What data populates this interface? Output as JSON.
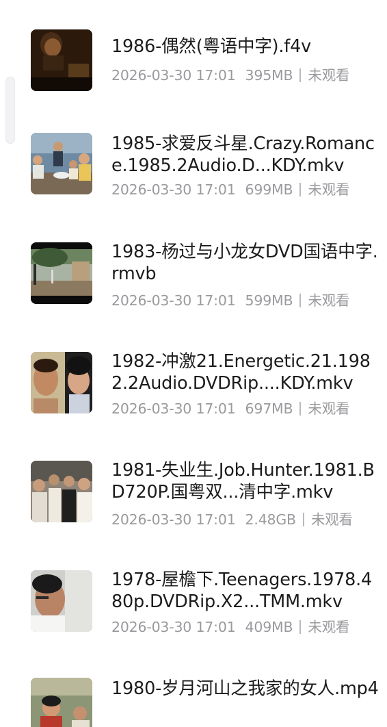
{
  "videos": [
    {
      "title": "1986-偶然(粤语中字).f4v",
      "date": "2026-03-30 17:01",
      "size": "395MB",
      "status": "未观看",
      "thumbnail": "dark-portrait-thumbnail"
    },
    {
      "title": "1985-求爱反斗星.Crazy.Romance.1985.2Audio.D...KDY.mkv",
      "date": "2026-03-30 17:01",
      "size": "699MB",
      "status": "未观看",
      "thumbnail": "classroom-group-thumbnail"
    },
    {
      "title": "1983-杨过与小龙女DVD国语中字.rmvb",
      "date": "2026-03-30 17:01",
      "size": "599MB",
      "status": "未观看",
      "thumbnail": "outdoor-tree-scene-thumbnail"
    },
    {
      "title": "1982-冲激21.Energetic.21.1982.2Audio.DVDRip....KDY.mkv",
      "date": "2026-03-30 17:01",
      "size": "697MB",
      "status": "未观看",
      "thumbnail": "two-people-closeup-thumbnail"
    },
    {
      "title": "1981-失业生.Job.Hunter.1981.BD720P.国粤双...清中字.mkv",
      "date": "2026-03-30 17:01",
      "size": "2.48GB",
      "status": "未观看",
      "thumbnail": "crowd-scene-thumbnail"
    },
    {
      "title": "1978-屋檐下.Teenagers.1978.480p.DVDRip.X2...TMM.mkv",
      "date": "2026-03-30 17:01",
      "size": "409MB",
      "status": "未观看",
      "thumbnail": "man-profile-thumbnail"
    },
    {
      "title": "1980-岁月河山之我家的女人.mp4",
      "date": "",
      "size": "",
      "status": "",
      "thumbnail": "poster-group-thumbnail"
    }
  ]
}
